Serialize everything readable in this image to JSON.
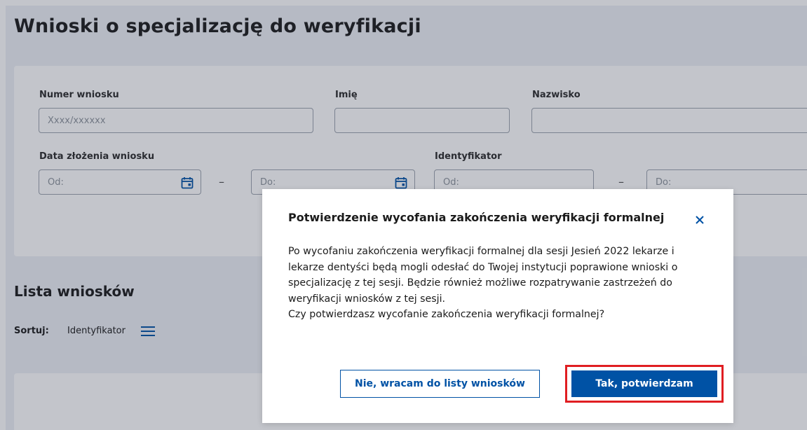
{
  "page": {
    "title": "Wnioski o specjalizację do weryfikacji"
  },
  "filters": {
    "numer_label": "Numer wniosku",
    "numer_placeholder": "Xxxx/xxxxxx",
    "imie_label": "Imię",
    "nazwisko_label": "Nazwisko",
    "data_label": "Data złożenia wniosku",
    "data_od_placeholder": "Od:",
    "data_do_placeholder": "Do:",
    "range_dash": "–",
    "identyfikator_label": "Identyfikator",
    "id_od_placeholder": "Od:",
    "id_do_placeholder": "Do:"
  },
  "list": {
    "title": "Lista wniosków",
    "sort_label": "Sortuj:",
    "sort_value": "Identyfikator"
  },
  "modal": {
    "title": "Potwierdzenie wycofania zakończenia weryfikacji formalnej",
    "body_line1": "Po wycofaniu zakończenia weryfikacji formalnej dla sesji Jesień 2022 lekarze i",
    "body_line2": "lekarze dentyści będą mogli odesłać do Twojej instytucji poprawione wnioski o",
    "body_line3": "specjalizację z tej sesji. Będzie również możliwe rozpatrywanie zastrzeżeń do",
    "body_line4": "weryfikacji wniosków z tej sesji.",
    "body_line5": "Czy potwierdzasz wycofanie zakończenia weryfikacji formalnej?",
    "cancel_label": "Nie, wracam do listy wniosków",
    "confirm_label": "Tak, potwierdzam"
  },
  "colors": {
    "primary": "#0052a5",
    "highlight": "#e01e22"
  },
  "icons": {
    "calendar": "calendar-icon",
    "close": "close-icon",
    "sort": "hamburger-icon"
  }
}
